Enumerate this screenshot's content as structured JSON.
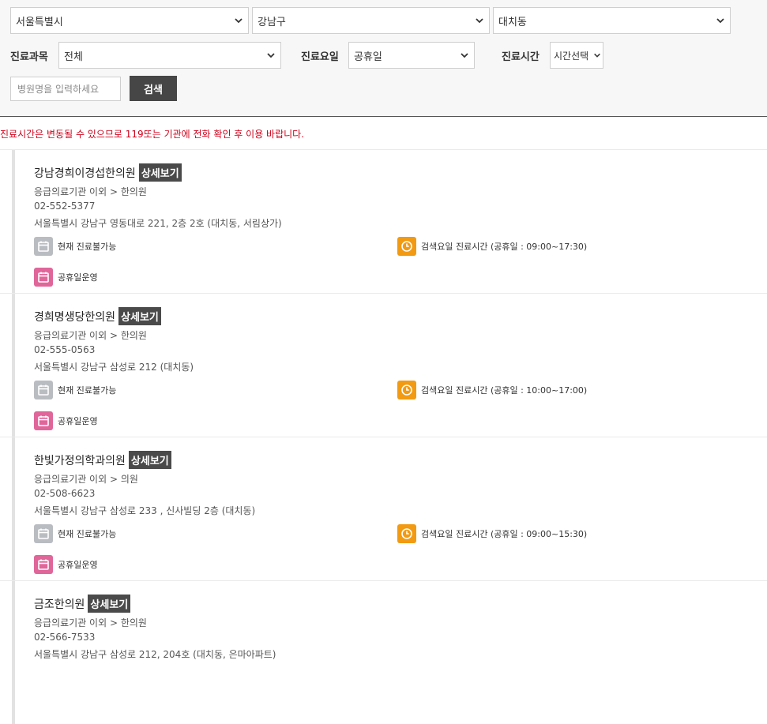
{
  "filters": {
    "city": "서울특별시",
    "district": "강남구",
    "dong": "대치동",
    "dept_label": "진료과목",
    "dept_value": "전체",
    "day_label": "진료요일",
    "day_value": "공휴일",
    "time_label": "진료시간",
    "time_value": "시간선택",
    "search_placeholder": "병원명을 입력하세요",
    "search_button": "검색"
  },
  "notice": "진료시간은 변동될 수 있으므로 119또는 기관에 전화 확인 후 이용 바랍니다.",
  "detail_label": "상세보기",
  "hospitals": [
    {
      "name": "강남경희이경섭한의원",
      "category": "응급의료기관 이외 > 한의원",
      "phone": "02-552-5377",
      "address": "서울특별시 강남구 영동대로 221, 2층 2호 (대치동, 서림상가)",
      "status": "현재 진료불가능",
      "hours": "검색요일 진료시간 (공휴일 : 09:00~17:30)",
      "holiday": "공휴일운영"
    },
    {
      "name": "경희명생당한의원",
      "category": "응급의료기관 이외 > 한의원",
      "phone": "02-555-0563",
      "address": "서울특별시 강남구 삼성로 212 (대치동)",
      "status": "현재 진료불가능",
      "hours": "검색요일 진료시간 (공휴일 : 10:00~17:00)",
      "holiday": "공휴일운영"
    },
    {
      "name": "한빛가정의학과의원",
      "category": "응급의료기관 이외 > 의원",
      "phone": "02-508-6623",
      "address": "서울특별시 강남구 삼성로 233 , 신사빌딩 2층 (대치동)",
      "status": "현재 진료불가능",
      "hours": "검색요일 진료시간 (공휴일 : 09:00~15:30)",
      "holiday": "공휴일운영"
    },
    {
      "name": "금조한의원",
      "category": "응급의료기관 이외 > 한의원",
      "phone": "02-566-7533",
      "address": "서울특별시 강남구 삼성로 212, 204호 (대치동, 은마아파트)",
      "status": "",
      "hours": "",
      "holiday": ""
    }
  ],
  "icons": {
    "status": "calendar-icon",
    "hours": "clock-icon",
    "holiday": "calendar-icon"
  },
  "colors": {
    "status_icon": "#b9bcc1",
    "hours_icon": "#f29a12",
    "holiday_icon": "#e0669a",
    "notice": "#d0021b",
    "button": "#464646"
  }
}
